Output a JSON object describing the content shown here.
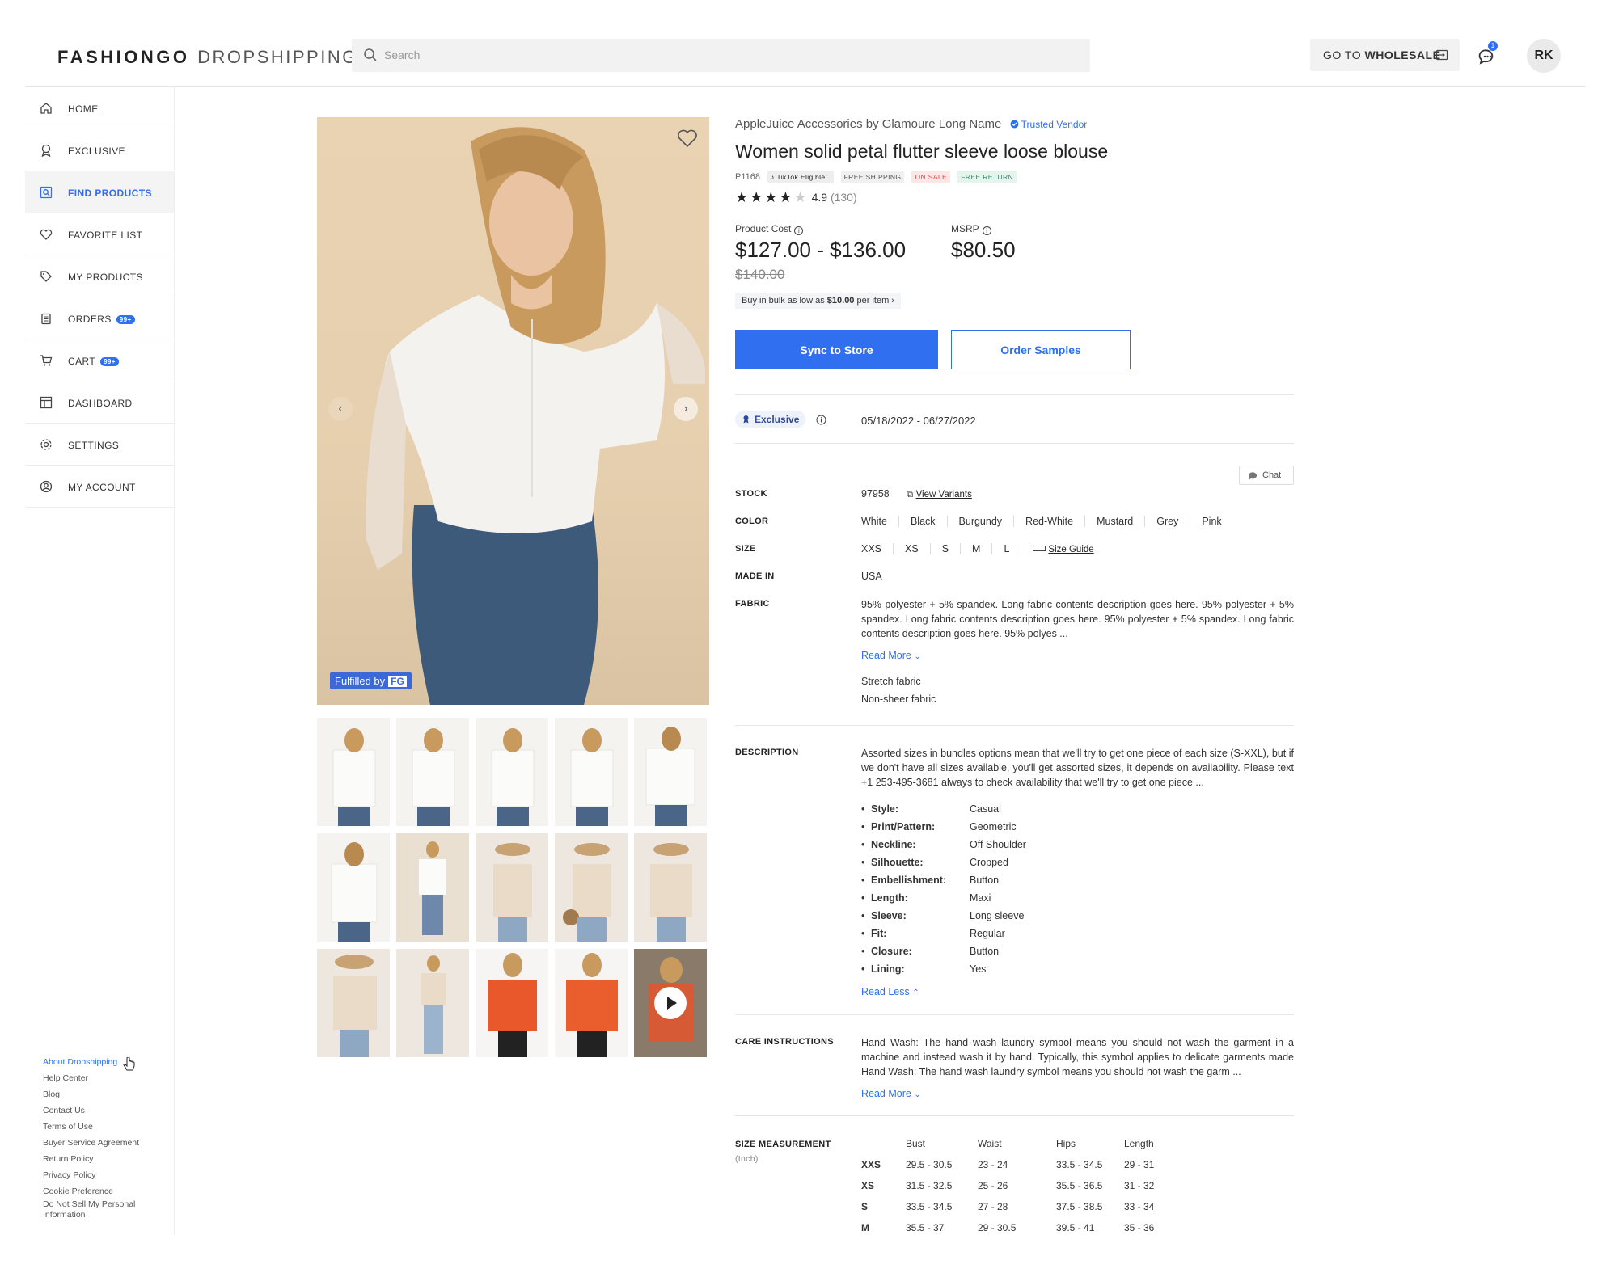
{
  "header": {
    "logo_brand": "FASHIONGO",
    "logo_sub": "DROPSHIPPING",
    "search_placeholder": "Search",
    "wholesale_prefix": "GO TO ",
    "wholesale_bold": "WHOLESALE",
    "chat_badge": "1",
    "avatar_initials": "RK"
  },
  "sidebar": {
    "items": [
      {
        "label": "HOME",
        "icon": "home-icon"
      },
      {
        "label": "EXCLUSIVE",
        "icon": "award-icon"
      },
      {
        "label": "FIND PRODUCTS",
        "icon": "search-product-icon"
      },
      {
        "label": "FAVORITE LIST",
        "icon": "heart-icon"
      },
      {
        "label": "MY PRODUCTS",
        "icon": "tag-icon"
      },
      {
        "label": "ORDERS",
        "icon": "clipboard-icon",
        "badge": "99+"
      },
      {
        "label": "CART",
        "icon": "cart-icon",
        "badge": "99+"
      },
      {
        "label": "DASHBOARD",
        "icon": "dashboard-icon"
      },
      {
        "label": "SETTINGS",
        "icon": "gear-icon"
      },
      {
        "label": "MY ACCOUNT",
        "icon": "user-icon"
      }
    ],
    "active": "FIND PRODUCTS",
    "footer_links": [
      "About Dropshipping",
      "Help Center",
      "Blog",
      "Contact Us",
      "Terms of Use",
      "Buyer Service Agreement",
      "Return Policy",
      "Privacy Policy",
      "Cookie Preference",
      "Do Not Sell My Personal Information"
    ]
  },
  "gallery": {
    "fulfilled_text": "Fulfilled by",
    "fulfilled_badge": "FG",
    "thumbnail_count": 15
  },
  "product": {
    "vendor": "AppleJuice Accessories by Glamoure Long Name",
    "trusted": "Trusted Vendor",
    "title": "Women solid petal flutter sleeve loose blouse",
    "sku": "P1168",
    "tags": {
      "tiktok": "TikTok Eligible",
      "free_shipping": "FREE SHIPPING",
      "on_sale": "ON SALE",
      "free_return": "FREE RETURN"
    },
    "rating_value": "4.9",
    "rating_count": "(130)",
    "rating_stars": 4,
    "cost_label": "Product Cost",
    "cost": "$127.00 - $136.00",
    "original_price": "$140.00",
    "msrp_label": "MSRP",
    "msrp": "$80.50",
    "bulk_prefix": "Buy in bulk as low as ",
    "bulk_price": "$10.00",
    "bulk_suffix": " per item ›",
    "sync_button": "Sync to Store",
    "sample_button": "Order Samples",
    "exclusive_label": "Exclusive",
    "exclusive_dates": "05/18/2022 - 06/27/2022",
    "chat_label": "Chat"
  },
  "details": {
    "stock_label": "STOCK",
    "stock_value": "97958",
    "view_variants": "View Variants",
    "color_label": "COLOR",
    "colors": [
      "White",
      "Black",
      "Burgundy",
      "Red-White",
      "Mustard",
      "Grey",
      "Pink"
    ],
    "size_label": "SIZE",
    "sizes": [
      "XXS",
      "XS",
      "S",
      "M",
      "L"
    ],
    "size_guide": "Size Guide",
    "made_in_label": "MADE IN",
    "made_in_value": "USA",
    "fabric_label": "FABRIC",
    "fabric_text": "95% polyester + 5% spandex. Long fabric contents description goes here. 95% polyester + 5% spandex. Long fabric contents description goes here. 95% polyester + 5% spandex. Long fabric contents description goes here. 95% polyes ...",
    "read_more": "Read More",
    "fabric_notes": [
      "Stretch fabric",
      "Non-sheer fabric"
    ],
    "description_label": "DESCRIPTION",
    "description_text": "Assorted sizes in bundles options mean that we'll try to get one piece of each size (S-XXL), but if we don't have all sizes available, you'll get assorted sizes, it depends on availability. Please text +1 253-495-3681 always to check availability that we'll try to get one piece ...",
    "attributes": [
      {
        "k": "Style:",
        "v": "Casual"
      },
      {
        "k": "Print/Pattern:",
        "v": "Geometric"
      },
      {
        "k": "Neckline:",
        "v": "Off Shoulder"
      },
      {
        "k": "Silhouette:",
        "v": "Cropped"
      },
      {
        "k": "Embellishment:",
        "v": "Button"
      },
      {
        "k": "Length:",
        "v": "Maxi"
      },
      {
        "k": "Sleeve:",
        "v": "Long sleeve"
      },
      {
        "k": "Fit:",
        "v": "Regular"
      },
      {
        "k": "Closure:",
        "v": "Button"
      },
      {
        "k": "Lining:",
        "v": "Yes"
      }
    ],
    "read_less": "Read Less",
    "care_label": "CARE INSTRUCTIONS",
    "care_text": "Hand Wash: The hand wash laundry symbol means you should not wash the garment in a machine and instead wash it by hand. Typically, this symbol applies to delicate garments made Hand Wash: The hand wash laundry symbol means you should not wash the garm ...",
    "size_measure_label": "SIZE MEASUREMENT",
    "size_measure_unit": "(Inch)",
    "size_table": {
      "headers": [
        "Bust",
        "Waist",
        "Hips",
        "Length"
      ],
      "rows": [
        [
          "XXS",
          "29.5 - 30.5",
          "23 - 24",
          "33.5 - 34.5",
          "29 - 31"
        ],
        [
          "XS",
          "31.5 - 32.5",
          "25 - 26",
          "35.5 - 36.5",
          "31 - 32"
        ],
        [
          "S",
          "33.5 - 34.5",
          "27 - 28",
          "37.5 - 38.5",
          "33 - 34"
        ],
        [
          "M",
          "35.5 - 37",
          "29 - 30.5",
          "39.5 - 41",
          "35 - 36"
        ]
      ]
    }
  },
  "colors": {
    "accent": "#2f6ff0",
    "sale": "#e04848",
    "free_return": "#3d8a6b"
  }
}
